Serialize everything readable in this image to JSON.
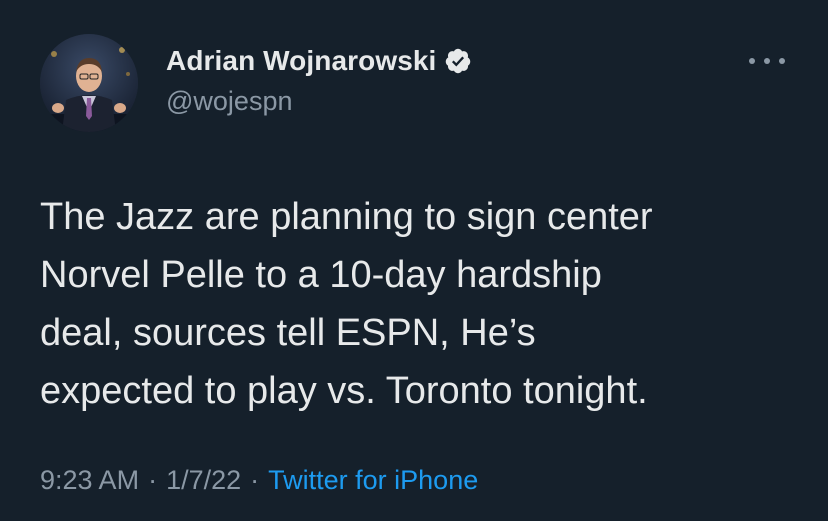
{
  "author": {
    "display_name": "Adrian Wojnarowski",
    "handle": "@wojespn",
    "verified_icon": "verified-badge-icon",
    "avatar_icon": "profile-avatar"
  },
  "menu": {
    "icon": "more-options-icon"
  },
  "tweet": {
    "text": "The Jazz are planning to sign center\nNorvel Pelle to a 10-day hardship\ndeal, sources tell ESPN, He’s\nexpected to play vs. Toronto tonight."
  },
  "meta": {
    "time": "9:23 AM",
    "separator": "·",
    "date": "1/7/22",
    "source": "Twitter for iPhone"
  },
  "colors": {
    "background": "#15202b",
    "text": "#e7e9ea",
    "secondary": "#8b98a5",
    "accent": "#1d9bf0"
  }
}
